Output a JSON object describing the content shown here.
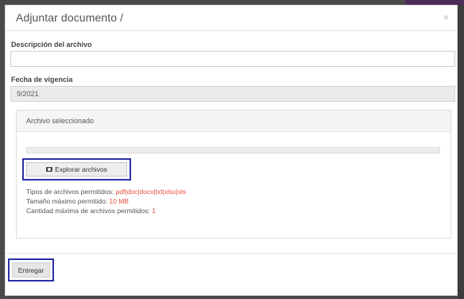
{
  "modal": {
    "title": "Adjuntar documento /",
    "close_label": "×"
  },
  "form": {
    "description_label": "Descripción del archivo",
    "description_value": "",
    "description_placeholder": "",
    "date_label": "Fecha de vigencia",
    "date_value": "9/2021"
  },
  "file_panel": {
    "title": "Archivo seleccionado",
    "progress": 0,
    "explore_label": "Explorar archivos",
    "explore_icon": "camera-icon",
    "allowed_types_label": "Tipos de archivos permitidos: ",
    "allowed_types_value": "pdf|doc|docx|txt|xlsx|xls",
    "max_size_label": "Tamaño máximo permitido: ",
    "max_size_value": "10 MB",
    "max_files_label": "Cantidad máxima de archivos permitidos: ",
    "max_files_value": "1"
  },
  "footer": {
    "submit_label": "Entregar"
  },
  "colors": {
    "highlight": "#2a2fa6",
    "value_red": "#e74c3c"
  }
}
